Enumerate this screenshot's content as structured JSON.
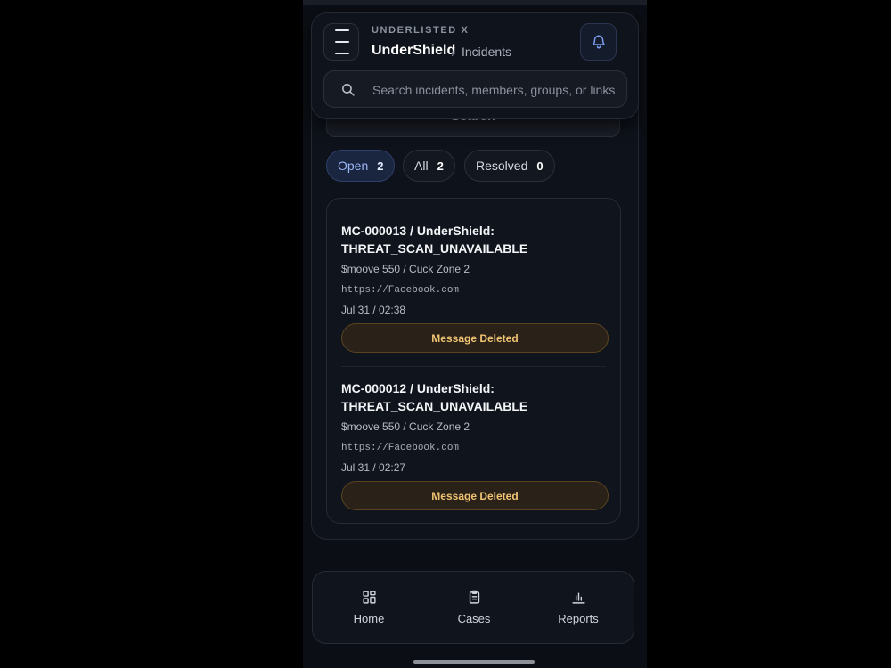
{
  "header": {
    "kicker": "UNDERLISTED X",
    "title": "UnderShield",
    "separator": "/",
    "page": "Incidents"
  },
  "search": {
    "placeholder": "Search incidents, members, groups, or links",
    "submit_label": "Search"
  },
  "filters": [
    {
      "label": "Open",
      "count": "2",
      "active": true
    },
    {
      "label": "All",
      "count": "2",
      "active": false
    },
    {
      "label": "Resolved",
      "count": "0",
      "active": false
    }
  ],
  "incidents": [
    {
      "title": "MC-000013 / UnderShield: THREAT_SCAN_UNAVAILABLE",
      "group": "$moove 550 / Cuck Zone 2",
      "link": "https://Facebook.com",
      "time": "Jul 31 / 02:38",
      "status": "Message Deleted"
    },
    {
      "title": "MC-000012 / UnderShield: THREAT_SCAN_UNAVAILABLE",
      "group": "$moove 550 / Cuck Zone 2",
      "link": "https://Facebook.com",
      "time": "Jul 31 / 02:27",
      "status": "Message Deleted"
    }
  ],
  "nav": [
    {
      "label": "Home",
      "icon": "grid-icon"
    },
    {
      "label": "Cases",
      "icon": "clipboard-icon"
    },
    {
      "label": "Reports",
      "icon": "bar-chart-icon"
    }
  ],
  "colors": {
    "background": "#0b0e14",
    "accent": "#9bb6f5",
    "status_warning": "#f1c473"
  }
}
